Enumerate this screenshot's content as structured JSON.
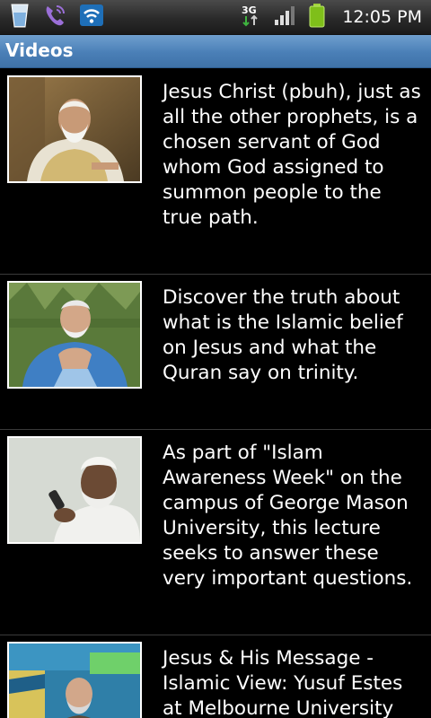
{
  "status_bar": {
    "time": "12:05 PM",
    "network_type": "3G",
    "icons": [
      "water-glass-icon",
      "phone-call-icon",
      "wifi-icon",
      "network-3g-icon",
      "signal-icon",
      "battery-icon"
    ]
  },
  "header": {
    "title": "Videos"
  },
  "videos": [
    {
      "description": "Jesus Christ (pbuh), just as all the other prophets, is a chosen servant of God whom God assigned to summon people to the true path."
    },
    {
      "description": "Discover the truth about what is the Islamic belief on Jesus and what the Quran say on trinity."
    },
    {
      "description": "As part of \"Islam Awareness Week\" on the campus of George Mason University, this lecture seeks to answer these very important questions."
    },
    {
      "description": "Jesus & His Message - Islamic View: Yusuf Estes at Melbourne University"
    }
  ],
  "colors": {
    "title_bar": "#4a7fb7",
    "background": "#000000",
    "text": "#ffffff",
    "divider": "#3a3a3a"
  }
}
